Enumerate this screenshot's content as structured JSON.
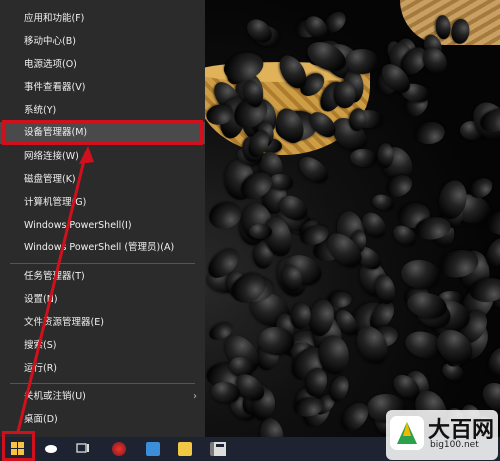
{
  "menu": {
    "items": [
      {
        "label": "应用和功能(F)"
      },
      {
        "label": "移动中心(B)"
      },
      {
        "label": "电源选项(O)"
      },
      {
        "label": "事件查看器(V)"
      },
      {
        "label": "系统(Y)"
      },
      {
        "label": "设备管理器(M)"
      },
      {
        "label": "网络连接(W)"
      },
      {
        "label": "磁盘管理(K)"
      },
      {
        "label": "计算机管理(G)"
      },
      {
        "label": "Windows PowerShell(I)"
      },
      {
        "label": "Windows PowerShell (管理员)(A)"
      },
      {
        "label": "任务管理器(T)"
      },
      {
        "label": "设置(N)"
      },
      {
        "label": "文件资源管理器(E)"
      },
      {
        "label": "搜索(S)"
      },
      {
        "label": "运行(R)"
      },
      {
        "label": "关机或注销(U)"
      },
      {
        "label": "桌面(D)"
      }
    ],
    "highlighted_item": "设备管理器(M)",
    "submenu_arrow": "›"
  },
  "taskbar": {
    "buttons": [
      {
        "icon": "windows-start-icon"
      },
      {
        "icon": "cortana-icon"
      },
      {
        "icon": "task-view-icon"
      },
      {
        "icon": "app-icon"
      },
      {
        "icon": "mail-icon"
      },
      {
        "icon": "folder-icon"
      },
      {
        "icon": "store-icon"
      },
      {
        "icon": "calculator-icon"
      }
    ]
  },
  "watermark": {
    "title": "大百网",
    "url": "big100.net"
  },
  "colors": {
    "menu_bg": "#2b2b2b",
    "highlight": "#4a4a4a",
    "annotation_red": "#d0101c",
    "taskbar": "#1d2330"
  }
}
